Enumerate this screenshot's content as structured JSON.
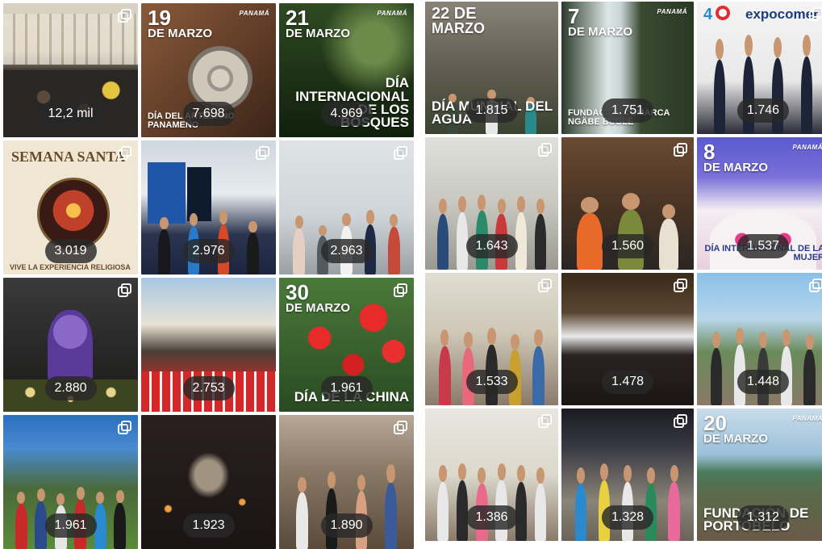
{
  "left_grid": [
    {
      "views": "12,2 mil",
      "multi": true
    },
    {
      "views": "7.698",
      "title_big": "19",
      "title_small": "DE MARZO",
      "bottom_text": "DÍA DEL ARTESANO PANAMEÑO",
      "brand": "PANAMÁ"
    },
    {
      "views": "4.969",
      "title_big": "21",
      "title_small": "DE MARZO",
      "bottom_text": "DÍA INTERNACIONAL DE LOS BOSQUES",
      "brand": "PANAMÁ"
    },
    {
      "views": "3.019",
      "title_big": "SEMANA SANTA",
      "bottom_text": "VIVE LA EXPERIENCIA RELIGIOSA",
      "multi": true
    },
    {
      "views": "2.976",
      "multi": true
    },
    {
      "views": "2.963",
      "multi": true
    },
    {
      "views": "2.880",
      "multi": true
    },
    {
      "views": "2.753"
    },
    {
      "views": "1.961",
      "title_big": "30",
      "title_small": "DE MARZO",
      "bottom_text": "DÍA DE LA CHINA",
      "multi": true
    },
    {
      "views": "1.961",
      "multi": true
    },
    {
      "views": "1.923"
    },
    {
      "views": "1.890",
      "multi": true
    }
  ],
  "right_grid": [
    {
      "views": "1.815",
      "title_big": "22 DE",
      "title_small": "MARZO",
      "bottom_text": "DÍA MUNDIAL DEL AGUA"
    },
    {
      "views": "1.751",
      "title_big": "7",
      "title_small": "DE MARZO",
      "bottom_text": "FUNDACIÓN COMARCA NGÄBE BUGLÉ",
      "brand": "PANAMÁ"
    },
    {
      "views": "1.746",
      "logo_text": "expocomer",
      "multi": true
    },
    {
      "views": "1.643",
      "multi": true
    },
    {
      "views": "1.560",
      "multi": true
    },
    {
      "views": "1.537",
      "title_big": "8",
      "title_small": "DE MARZO",
      "bottom_text": "DÍA INTERNACIONAL DE LA MUJER",
      "brand": "PANAMÁ"
    },
    {
      "views": "1.533",
      "multi": true
    },
    {
      "views": "1.478",
      "multi": true
    },
    {
      "views": "1.448",
      "multi": true
    },
    {
      "views": "1.386",
      "multi": true
    },
    {
      "views": "1.328",
      "multi": true
    },
    {
      "views": "1.312",
      "title_big": "20",
      "title_small": "DE MARZO",
      "bottom_text": "FUNDACIÓN DE PORTOBELO",
      "brand": "PANAMÁ"
    }
  ]
}
